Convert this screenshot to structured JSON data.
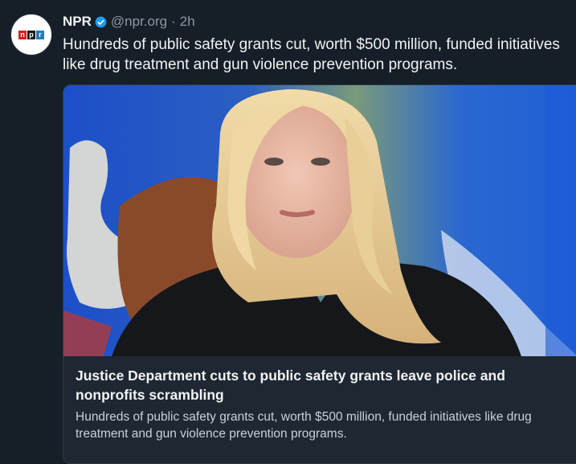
{
  "post": {
    "author_name": "NPR",
    "handle": "@npr.org",
    "separator": "·",
    "time": "2h",
    "text": "Hundreds of public safety grants cut, worth $500 million, funded initiatives like drug treatment and gun violence prevention programs.",
    "avatar_icon": "npr-logo",
    "verified_icon": "verified-badge-icon",
    "colors": {
      "accent": "#1d9bf0",
      "background": "#161e27"
    }
  },
  "card": {
    "image_alt_icon": "article-photo",
    "title": "Justice Department cuts to public safety grants leave police and nonprofits scrambling",
    "description": "Hundreds of public safety grants cut, worth $500 million, funded initiatives like drug treatment and gun violence prevention programs."
  }
}
